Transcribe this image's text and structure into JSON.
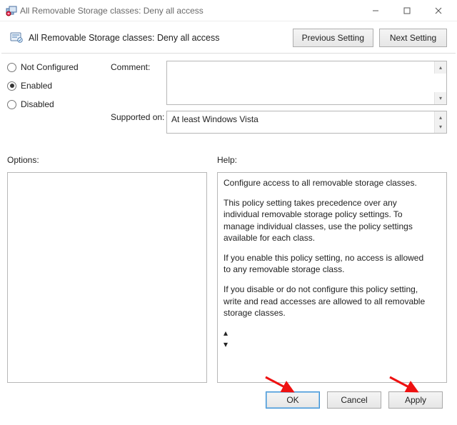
{
  "window": {
    "title": "All Removable Storage classes: Deny all access"
  },
  "header": {
    "policy_title": "All Removable Storage classes: Deny all access",
    "prev": "Previous Setting",
    "next": "Next Setting"
  },
  "state": {
    "not_configured": "Not Configured",
    "enabled": "Enabled",
    "disabled": "Disabled",
    "selected": "Enabled"
  },
  "fields": {
    "comment_label": "Comment:",
    "comment_value": "",
    "supported_label": "Supported on:",
    "supported_value": "At least Windows Vista"
  },
  "section": {
    "options": "Options:",
    "help": "Help:"
  },
  "help": {
    "p1": "Configure access to all removable storage classes.",
    "p2": "This policy setting takes precedence over any individual removable storage policy settings. To manage individual classes, use the policy settings available for each class.",
    "p3": "If you enable this policy setting, no access is allowed to any removable storage class.",
    "p4": "If you disable or do not configure this policy setting, write and read accesses are allowed to all removable storage classes."
  },
  "buttons": {
    "ok": "OK",
    "cancel": "Cancel",
    "apply": "Apply"
  }
}
